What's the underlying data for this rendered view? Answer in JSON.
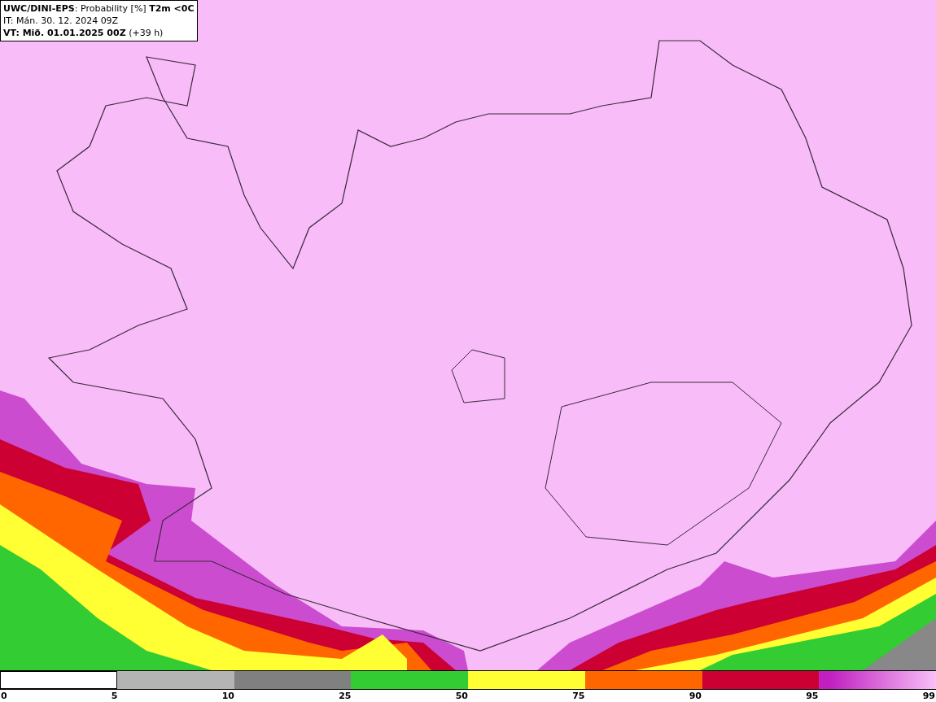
{
  "header": {
    "lines": [
      "**UWC/DINI-EPS**: Probability [%] **T2m <0C**",
      "IT: Mán. 30. 12. 2024 09Z",
      "**VT: Mið. 01.01.2025 00Z** (+39 h)"
    ]
  },
  "legend": {
    "segments": [
      {
        "color": "#ffffff"
      },
      {
        "color": "#b4b4b4"
      },
      {
        "color": "#808080"
      },
      {
        "color": "#33cc33"
      },
      {
        "color": "#ffff33"
      },
      {
        "color": "#ff6600"
      },
      {
        "color": "#cc0033"
      },
      {
        "color": "#c020c0"
      }
    ],
    "ticks": [
      "0",
      "5",
      "10",
      "25",
      "50",
      "75",
      "90",
      "95",
      "99"
    ]
  }
}
